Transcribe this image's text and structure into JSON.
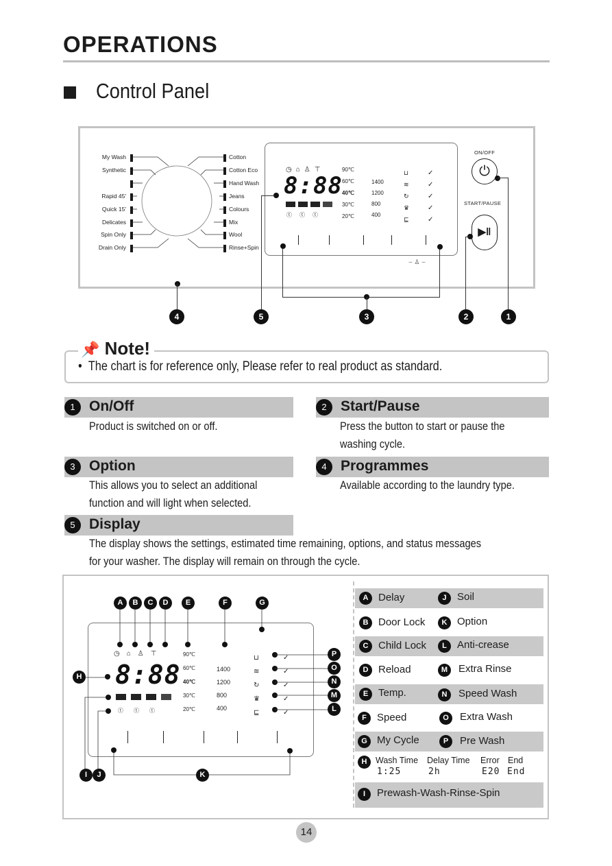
{
  "header": {
    "title": "OPERATIONS",
    "subtitle": "Control Panel"
  },
  "panel": {
    "programmes_left": [
      "My Wash",
      "Synthetic",
      "",
      "Rapid 45'",
      "Quick 15'",
      "Delicates",
      "Spin Only",
      "Drain Only"
    ],
    "programmes_right": [
      "Cotton",
      "Cotton Eco",
      "Hand Wash",
      "Jeans",
      "Colours",
      "Mix",
      "Wool",
      "Rinse+Spin"
    ],
    "display_digits": "8:88",
    "temps": [
      "90℃",
      "60℃",
      "40℃",
      "30℃",
      "20℃"
    ],
    "speeds": [
      "1400",
      "1200",
      "800",
      "400"
    ],
    "on_off_label": "ON/OFF",
    "start_pause_label": "START/PAUSE",
    "callouts": [
      "4",
      "5",
      "3",
      "2",
      "1"
    ]
  },
  "note": {
    "title": "Note!",
    "text": "The chart is for reference only, Please refer to real product as standard."
  },
  "sections": [
    {
      "num": "1",
      "title": "On/Off",
      "body": [
        "Product is switched on or off."
      ]
    },
    {
      "num": "2",
      "title": "Start/Pause",
      "body": [
        "Press the button to start or pause the",
        "washing cycle."
      ]
    },
    {
      "num": "3",
      "title": "Option",
      "body": [
        "This allows you to select an additional",
        "function and will light when selected."
      ]
    },
    {
      "num": "4",
      "title": "Programmes",
      "body": [
        "Available according to the laundry type."
      ]
    },
    {
      "num": "5",
      "title": "Display",
      "body": [
        "The display shows the settings, estimated time remaining, options, and status messages",
        " for your washer. The display will remain on through the cycle."
      ]
    }
  ],
  "display_diagram": {
    "top_labels": [
      "A",
      "B",
      "C",
      "D",
      "E",
      "F",
      "G"
    ],
    "right_labels": [
      "P",
      "O",
      "N",
      "M",
      "L"
    ],
    "left_label": "H",
    "bottom_labels": [
      "I",
      "J",
      "K"
    ],
    "digits": "8:88",
    "temps": [
      "90℃",
      "60℃",
      "40℃",
      "30℃",
      "20℃"
    ],
    "speeds": [
      "1400",
      "1200",
      "800",
      "400"
    ]
  },
  "legend": {
    "rows": [
      {
        "l": "A",
        "lt": "Delay",
        "r": "J",
        "rt": "Soil"
      },
      {
        "l": "B",
        "lt": "Door Lock",
        "r": "K",
        "rt": "Option"
      },
      {
        "l": "C",
        "lt": "Child Lock",
        "r": "L",
        "rt": "Anti-crease"
      },
      {
        "l": "D",
        "lt": "Reload",
        "r": "M",
        "rt": "Extra Rinse"
      },
      {
        "l": "E",
        "lt": "Temp.",
        "r": "N",
        "rt": "Speed Wash"
      },
      {
        "l": "F",
        "lt": "Speed",
        "r": "O",
        "rt": "Extra Wash"
      },
      {
        "l": "G",
        "lt": "My Cycle",
        "r": "P",
        "rt": "Pre Wash"
      }
    ],
    "h": {
      "label": "H",
      "items": [
        {
          "title": "Wash Time",
          "value": "1:25"
        },
        {
          "title": "Delay Time",
          "value": "2h"
        },
        {
          "title": "Error",
          "value": "E20"
        },
        {
          "title": "End",
          "value": "End"
        }
      ]
    },
    "i": {
      "label": "I",
      "text": "Prewash-Wash-Rinse-Spin"
    }
  },
  "page_number": "14"
}
